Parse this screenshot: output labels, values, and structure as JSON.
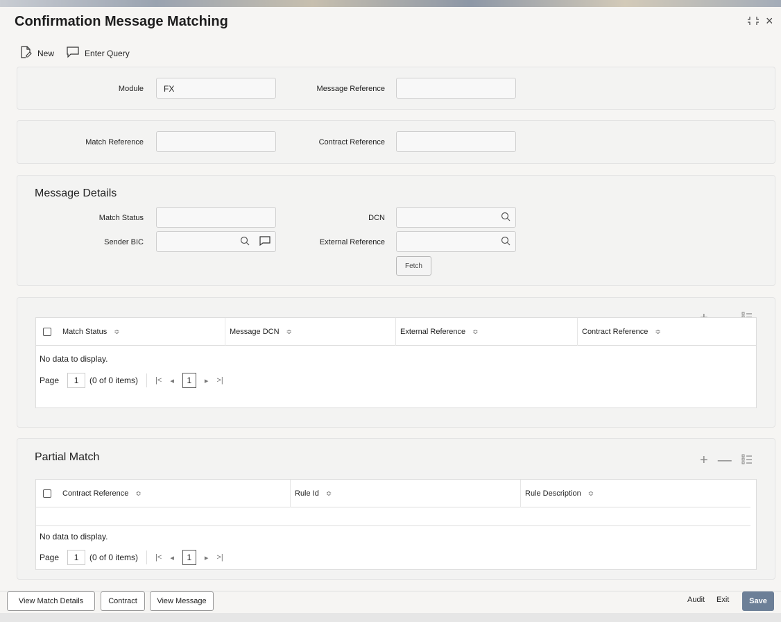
{
  "title": "Confirmation Message Matching",
  "window_controls": {
    "restore_icon": "collapse-icon",
    "close_glyph": "×"
  },
  "toolbar": {
    "new_label": "New",
    "enter_query_label": "Enter Query"
  },
  "query": {
    "module_label": "Module",
    "module_value": "FX",
    "message_reference_label": "Message Reference",
    "message_reference_value": "",
    "match_reference_label": "Match Reference",
    "match_reference_value": "",
    "contract_reference_label": "Contract Reference",
    "contract_reference_value": ""
  },
  "message_details": {
    "title": "Message Details",
    "match_status_label": "Match Status",
    "match_status_value": "",
    "dcn_label": "DCN",
    "dcn_value": "",
    "sender_bic_label": "Sender BIC",
    "sender_bic_value": "",
    "external_reference_label": "External Reference",
    "external_reference_value": "",
    "fetch_label": "Fetch"
  },
  "match_table": {
    "columns": [
      "Match Status",
      "Message DCN",
      "External Reference",
      "Contract Reference"
    ],
    "empty_text": "No data to display.",
    "page_label": "Page",
    "page_value": "1",
    "items_text": "(0 of 0 items)",
    "current_page": "1"
  },
  "partial_match": {
    "title": "Partial Match",
    "columns": [
      "Contract Reference",
      "Rule Id",
      "Rule Description"
    ],
    "empty_text": "No data to display.",
    "page_label": "Page",
    "page_value": "1",
    "items_text": "(0 of 0 items)",
    "current_page": "1"
  },
  "footer": {
    "view_match_details_label": "View Match Details",
    "contract_label": "Contract",
    "view_message_label": "View Message",
    "audit_label": "Audit",
    "exit_label": "Exit",
    "save_label": "Save"
  },
  "colors": {
    "save_button": "#6c7f97",
    "panel_bg": "#f3f3f2"
  }
}
